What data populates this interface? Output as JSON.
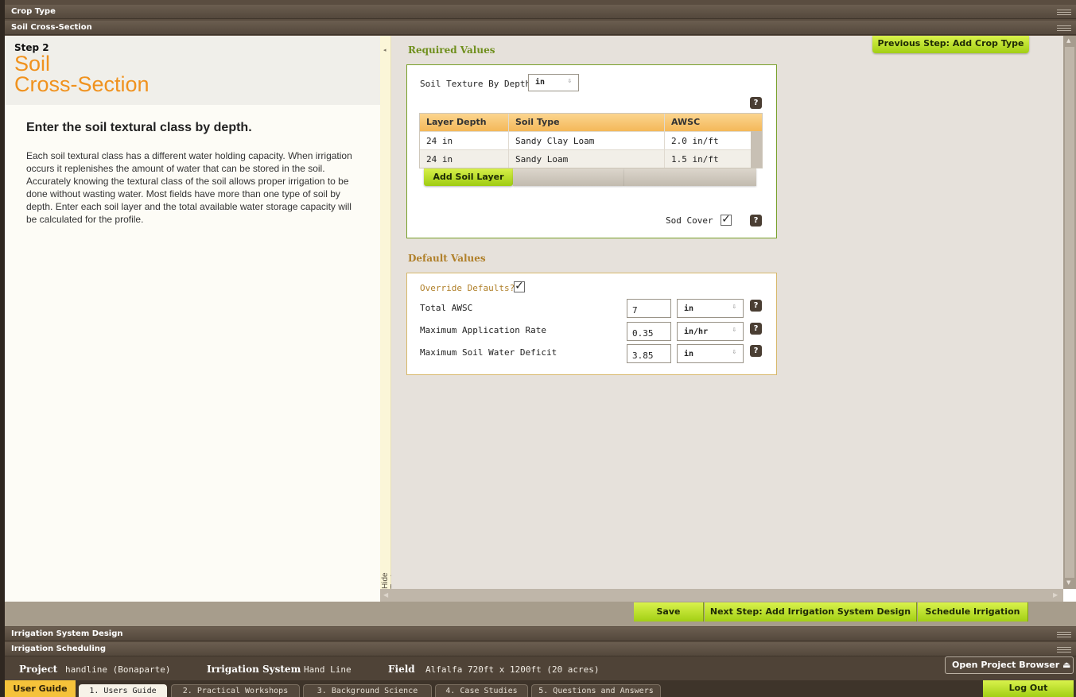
{
  "accordion": {
    "crop_type": "Crop Type",
    "soil_cross_section": "Soil Cross-Section",
    "irrigation_system_design": "Irrigation System Design",
    "irrigation_scheduling": "Irrigation Scheduling"
  },
  "left_panel": {
    "step_label": "Step 2",
    "step_title_line1": "Soil",
    "step_title_line2": "Cross-Section",
    "heading": "Enter the soil textural class by depth.",
    "body": "Each soil textural class has a different water holding capacity. When irrigation occurs it replenishes the amount of water that can be stored in the soil. Accurately knowing the textural class of the soil allows proper irrigation to be done without wasting water. Most fields have more than one type of soil by depth. Enter each soil layer and the total available water storage capacity will be calculated for the profile.",
    "hide_text": "Hide Text"
  },
  "top_buttons": {
    "previous_step": "Previous Step: Add Crop Type"
  },
  "required_values": {
    "title": "Required Values",
    "texture_label": "Soil Texture By Depth",
    "texture_unit": "in",
    "table": {
      "headers": [
        "Layer Depth",
        "Soil Type",
        "AWSC"
      ],
      "rows": [
        [
          "24 in",
          "Sandy Clay Loam",
          "2.0 in/ft"
        ],
        [
          "24 in",
          "Sandy Loam",
          "1.5 in/ft"
        ]
      ]
    },
    "add_soil_layer": "Add Soil Layer",
    "sod_cover_label": "Sod Cover",
    "sod_cover_checked": true
  },
  "default_values": {
    "title": "Default Values",
    "override_label": "Override Defaults?",
    "override_checked": true,
    "fields": [
      {
        "label": "Total AWSC",
        "value": "7",
        "unit": "in"
      },
      {
        "label": "Maximum Application Rate",
        "value": "0.35",
        "unit": "in/hr"
      },
      {
        "label": "Maximum Soil Water Deficit",
        "value": "3.85",
        "unit": "in"
      }
    ]
  },
  "actions": {
    "save": "Save",
    "next_step": "Next Step: Add Irrigation System Design",
    "schedule": "Schedule Irrigation"
  },
  "project_bar": {
    "project_key": "Project",
    "project_value": "handline  (Bonaparte)",
    "system_key": "Irrigation System",
    "system_value": "Hand Line",
    "field_key": "Field",
    "field_value": "Alfalfa  720ft x 1200ft  (20 acres)",
    "open_browser": "Open Project Browser"
  },
  "tabs": {
    "user_guide": "User Guide",
    "items": [
      "1. Users Guide",
      "2. Practical Workshops",
      "3. Background Science",
      "4. Case Studies",
      "5. Questions and Answers"
    ],
    "logout": "Log Out"
  },
  "icons": {
    "help": "?",
    "check": "✓",
    "caret": "⇩",
    "collapse": "◂",
    "eject": "⏏"
  },
  "colors": {
    "accent_orange": "#f0921e",
    "button_green": "#a2cf14",
    "required_green": "#6f8f1c",
    "default_gold": "#b0802a",
    "chrome_brown": "#54483c"
  }
}
